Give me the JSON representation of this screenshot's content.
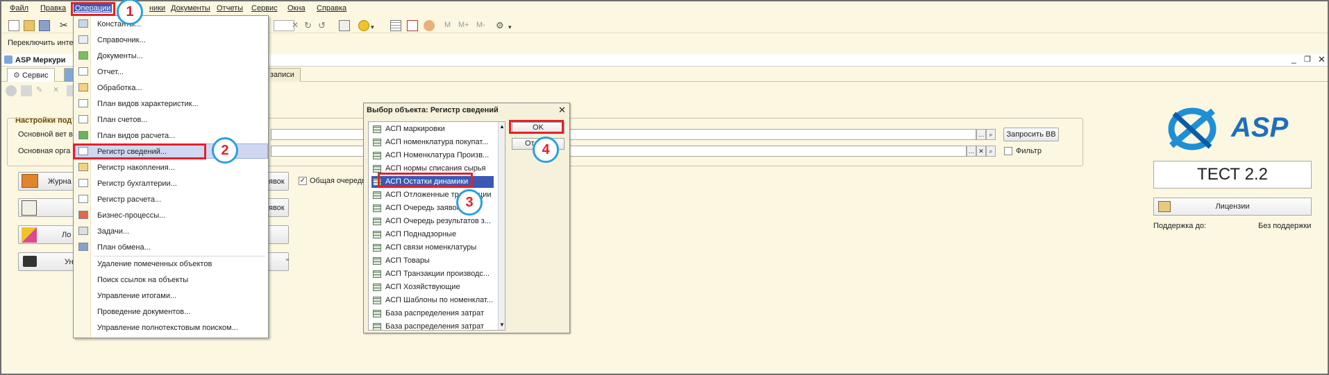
{
  "menubar": {
    "items": [
      "Файл",
      "Правка",
      "Операции",
      "Справочники",
      "Документы",
      "Отчеты",
      "Сервис",
      "Окна",
      "Справка"
    ],
    "partial_label": "ники"
  },
  "toolbar": {
    "m_labels": [
      "M",
      "M+",
      "M-"
    ],
    "interface_text": "Переключить инте"
  },
  "window": {
    "title": "ASP Меркури"
  },
  "tabs": {
    "service": "Сервис",
    "records": "записи"
  },
  "operations_menu": {
    "items": [
      "Константы...",
      "Справочник...",
      "Документы...",
      "Отчет...",
      "Обработка...",
      "План видов характеристик...",
      "План счетов...",
      "План видов расчета...",
      "Регистр сведений...",
      "Регистр накопления...",
      "Регистр бухгалтерии...",
      "Регистр расчета...",
      "Бизнес-процессы...",
      "Задачи...",
      "План обмена..."
    ],
    "items2": [
      "Удаление помеченных объектов",
      "Поиск ссылок на объекты",
      "Управление итогами...",
      "Проведение документов...",
      "Управление полнотекстовым поиском..."
    ]
  },
  "settings": {
    "group_title": "Настройки под",
    "row1_label": "Основной вет в",
    "row2_label": "Основная орга",
    "request_button": "Запросить ВВ",
    "filter_label": "Фильтр",
    "common_queue_label": "Общая очередь",
    "btn1": "Журна",
    "btn1_right": "явок",
    "btn2_right": "явок",
    "btn3": "Ло",
    "btn4": "Ун",
    "btn4_right": "\""
  },
  "dialog": {
    "title": "Выбор объекта: Регистр сведений",
    "ok": "OK",
    "cancel": "От",
    "items": [
      "АСП маркировки",
      "АСП номенклатура покупат...",
      "АСП Номенклатура Произв...",
      "АСП нормы списания сырья",
      "АСП Остатки динамики",
      "АСП Отложенные транзакции",
      "АСП Очередь заявок",
      "АСП Очередь результатов з...",
      "АСП Поднадзорные",
      "АСП связи номенклатуры",
      "АСП Товары",
      "АСП Транзакции производс...",
      "АСП Хозяйствующие",
      "АСП Шаблоны по номенклат...",
      "База распределения затрат",
      "База распределения затрат"
    ],
    "selected_index": 4
  },
  "right_panel": {
    "logo_text": "ASP",
    "version": "ТЕСТ 2.2",
    "licenses_button": "Лицензии",
    "support_label": "Поддержка до:",
    "support_value": "Без поддержки"
  },
  "steps": [
    "1",
    "2",
    "3",
    "4"
  ],
  "colors": {
    "accent_red": "#e5202a",
    "badge_blue": "#2a9fe0",
    "selection": "#3b58b4",
    "background": "#fbf7e1"
  }
}
